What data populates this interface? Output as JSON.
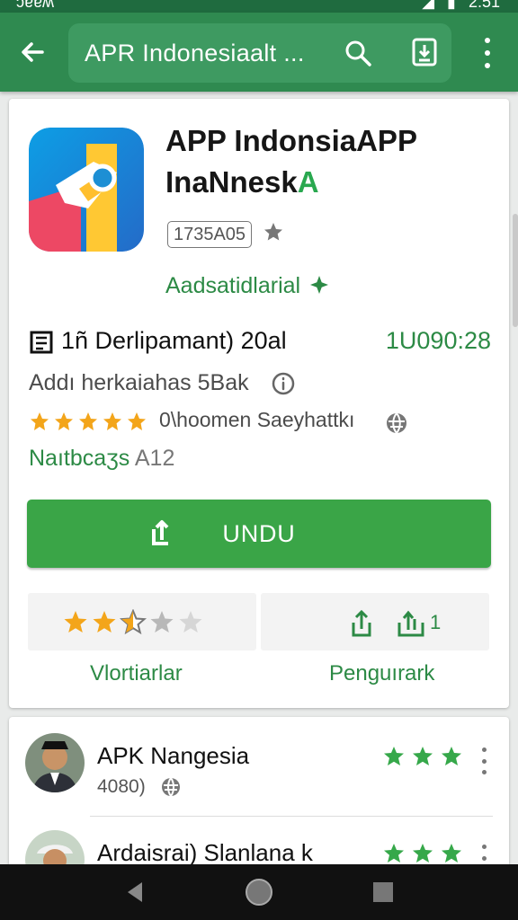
{
  "status": {
    "left": "ɔɐɐʍ",
    "time": "2:51"
  },
  "search": {
    "query": "APR Indonesiaalt ..."
  },
  "app": {
    "title_main": "APP IndonsiaAPP InaNnesk",
    "title_accent": "A",
    "badge": "1735A05",
    "developer": "Aadsatidlarial",
    "install_label": "1ñ Derlipamant) 20al",
    "install_time": "1U090:28",
    "description": "Addı herkaiahas 5Bak",
    "rating_text": "0\\hoomen Saeyhattkı",
    "category": "Naıtbcaʒs",
    "category_suffix": "A12",
    "download_label": "UNDU",
    "rating_value": 2.5,
    "rate_label": "Vlortiarlar",
    "share_count": "1",
    "share_label": "Penguırark"
  },
  "reviews": [
    {
      "name": "APK Nangesia",
      "meta": "4080)",
      "stars": 3
    },
    {
      "name": "Ardaisrai) Slanlana k",
      "meta": "",
      "stars": 3
    }
  ],
  "colors": {
    "app_bar": "#2f8a50",
    "accent": "#2c8a45",
    "download": "#3aa547"
  },
  "icons": [
    "back-arrow-icon",
    "search-icon",
    "voice-search-icon",
    "more-vert-icon",
    "app-icon",
    "badge-star-icon",
    "developer-verified-icon",
    "document-icon",
    "info-icon",
    "star-icon",
    "globe-icon",
    "download-icon",
    "share-icon",
    "nav-back-icon",
    "nav-home-icon",
    "nav-recents-icon"
  ]
}
